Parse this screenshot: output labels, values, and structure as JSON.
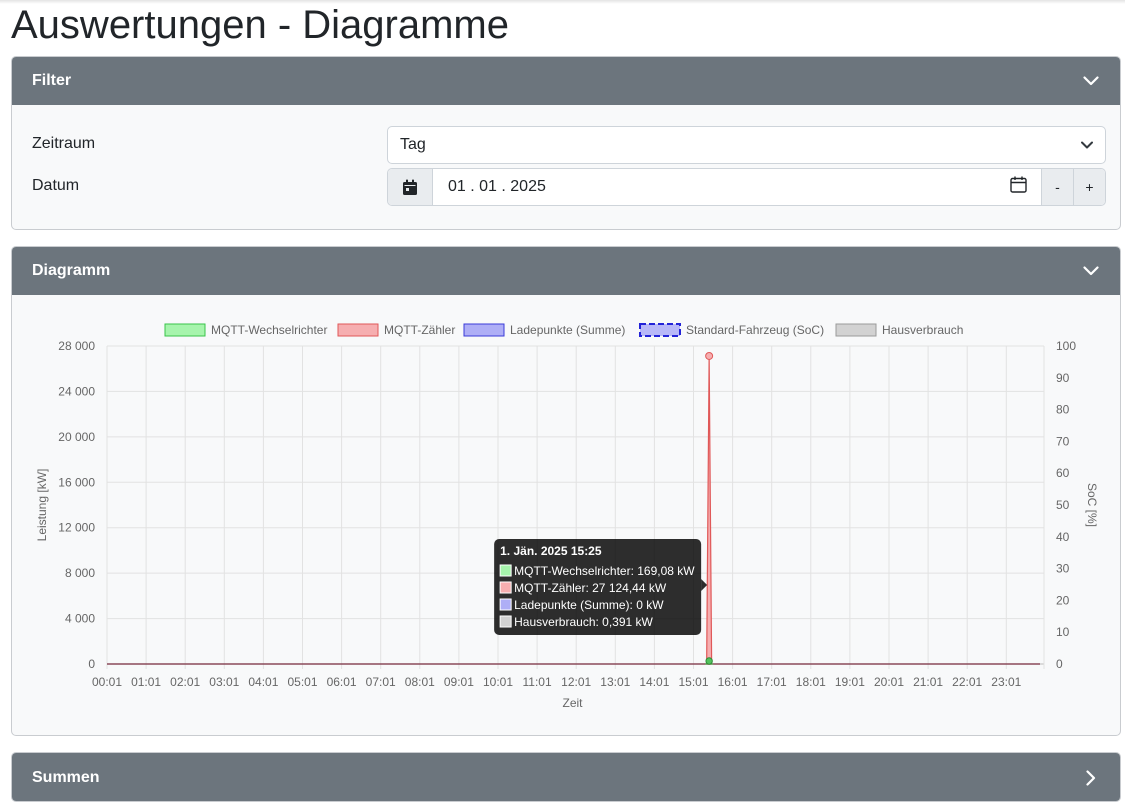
{
  "page": {
    "title": "Auswertungen - Diagramme"
  },
  "filter": {
    "header": "Filter",
    "zeitraum_label": "Zeitraum",
    "zeitraum_value": "Tag",
    "datum_label": "Datum",
    "datum_value": "01 . 01 . 2025",
    "minus_label": "-",
    "plus_label": "+"
  },
  "diagram": {
    "header": "Diagramm"
  },
  "summen": {
    "header": "Summen"
  },
  "colors": {
    "header_bg": "#6c757d",
    "card_bg": "#f8f9fa",
    "wechselrichter": "#9ef4a5",
    "zaehler": "#f5a3a6",
    "ladepunkte": "#a9a9f5",
    "soc_border": "#2929e0",
    "hausverbrauch": "#c9c9c9"
  },
  "chart_data": {
    "type": "area",
    "legend": [
      {
        "label": "MQTT-Wechselrichter",
        "fill": "#a6f4ac",
        "stroke": "#39c449",
        "dashed": false
      },
      {
        "label": "MQTT-Zähler",
        "fill": "#f6aeb0",
        "stroke": "#e05858",
        "dashed": false
      },
      {
        "label": "Ladepunkte (Summe)",
        "fill": "#aeaef6",
        "stroke": "#3a3ad8",
        "dashed": false
      },
      {
        "label": "Standard-Fahrzeug (SoC)",
        "fill": "#b8b8f8",
        "stroke": "#2323d8",
        "dashed": true
      },
      {
        "label": "Hausverbrauch",
        "fill": "#d2d2d2",
        "stroke": "#9a9a9a",
        "dashed": false
      }
    ],
    "x_labels": [
      "00:01",
      "01:01",
      "02:01",
      "03:01",
      "04:01",
      "05:01",
      "06:01",
      "07:01",
      "08:01",
      "09:01",
      "10:01",
      "11:01",
      "12:01",
      "13:01",
      "14:01",
      "15:01",
      "16:01",
      "17:01",
      "18:01",
      "19:01",
      "20:01",
      "21:01",
      "22:01",
      "23:01"
    ],
    "xlabel": "Zeit",
    "ylabel": "Leistung [kW]",
    "y_ticks": [
      "0",
      "4 000",
      "8 000",
      "12 000",
      "16 000",
      "20 000",
      "24 000",
      "28 000"
    ],
    "ylim": [
      0,
      28000
    ],
    "y2label": "SoC [%]",
    "y2_ticks": [
      "0",
      "10",
      "20",
      "30",
      "40",
      "50",
      "60",
      "70",
      "80",
      "90",
      "100"
    ],
    "y2lim": [
      0,
      100
    ],
    "series": [
      {
        "name": "MQTT-Wechselrichter",
        "points": [
          [
            "15:25",
            169.08
          ]
        ]
      },
      {
        "name": "MQTT-Zähler",
        "points": [
          [
            "15:25",
            27124.44
          ]
        ]
      },
      {
        "name": "Ladepunkte (Summe)",
        "points": [
          [
            "15:25",
            0
          ]
        ]
      },
      {
        "name": "Hausverbrauch",
        "points": [
          [
            "15:25",
            0.391
          ]
        ]
      }
    ],
    "spike_time": "15:25",
    "tooltip": {
      "title": "1. Jän. 2025 15:25",
      "items": [
        {
          "label": "MQTT-Wechselrichter: 169,08 kW",
          "color": "#a6f4ac"
        },
        {
          "label": "MQTT-Zähler: 27 124,44 kW",
          "color": "#f6aeb0"
        },
        {
          "label": "Ladepunkte (Summe): 0 kW",
          "color": "#aeaef6"
        },
        {
          "label": "Hausverbrauch: 0,391 kW",
          "color": "#d2d2d2"
        }
      ]
    }
  }
}
